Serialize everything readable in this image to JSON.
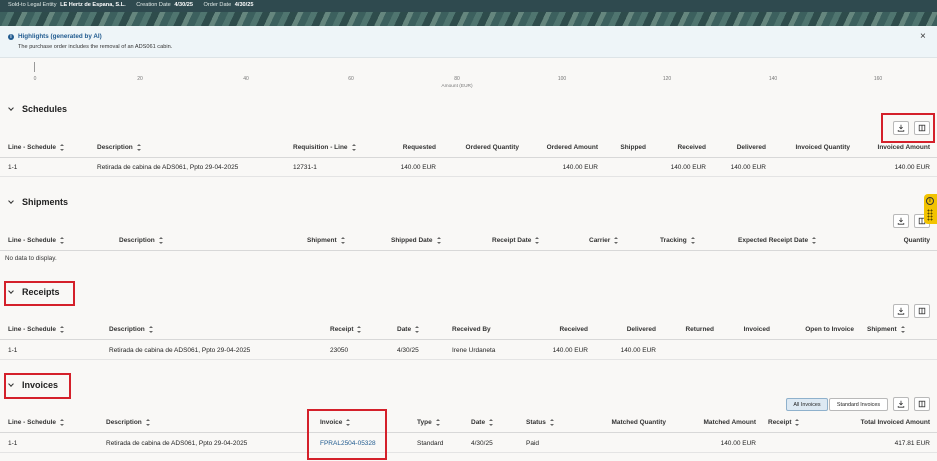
{
  "header": {
    "legal_entity_label": "Sold-to Legal Entity",
    "legal_entity_value": "LE Hertz de Espana, S.L.",
    "creation_date_label": "Creation Date",
    "creation_date_value": "4/30/25",
    "order_date_label": "Order Date",
    "order_date_value": "4/30/25"
  },
  "highlights": {
    "icon": "info-icon",
    "title": "Highlights (generated by AI)",
    "text": "The purchase order includes the removal of an ADS061 cabin.",
    "close_icon": "close-icon"
  },
  "axis": {
    "ticks": [
      "0",
      "20",
      "40",
      "60",
      "80",
      "100",
      "120",
      "140",
      "160"
    ],
    "title": "Amount (EUR)"
  },
  "schedules": {
    "title": "Schedules",
    "columns": [
      "Line - Schedule",
      "Description",
      "Requisition - Line",
      "Requested",
      "Ordered Quantity",
      "Ordered Amount",
      "Shipped",
      "Received",
      "Delivered",
      "Invoiced Quantity",
      "Invoiced Amount"
    ],
    "rows": [
      [
        "1-1",
        "Retirada de cabina de ADS061, Ppto 29-04-2025",
        "12731-1",
        "140.00 EUR",
        "",
        "140.00 EUR",
        "",
        "140.00 EUR",
        "140.00 EUR",
        "",
        "140.00 EUR"
      ]
    ]
  },
  "shipments": {
    "title": "Shipments",
    "columns": [
      "Line - Schedule",
      "Description",
      "Shipment",
      "Shipped Date",
      "Receipt Date",
      "Carrier",
      "Tracking",
      "Expected Receipt Date",
      "Quantity"
    ],
    "empty": "No data to display."
  },
  "receipts": {
    "title": "Receipts",
    "columns": [
      "Line - Schedule",
      "Description",
      "Receipt",
      "Date",
      "Received By",
      "Received",
      "Delivered",
      "Returned",
      "Invoiced",
      "Open to Invoice",
      "Shipment"
    ],
    "rows": [
      [
        "1-1",
        "Retirada de cabina de ADS061, Ppto 29-04-2025",
        "23050",
        "4/30/25",
        "Irene Urdaneta",
        "140.00 EUR",
        "140.00 EUR",
        "",
        "",
        "",
        ""
      ]
    ]
  },
  "invoices": {
    "title": "Invoices",
    "filter_all": "All Invoices",
    "filter_standard": "Standard Invoices",
    "columns": [
      "Line - Schedule",
      "Description",
      "Invoice",
      "Type",
      "Date",
      "Status",
      "Matched Quantity",
      "Matched Amount",
      "Receipt",
      "Total Invoiced Amount"
    ],
    "rows": [
      [
        "1-1",
        "Retirada de cabina de ADS061, Ppto 29-04-2025",
        "FPRAL2504-05328",
        "Standard",
        "4/30/25",
        "Paid",
        "",
        "140.00 EUR",
        "",
        "417.81 EUR"
      ]
    ]
  },
  "icons": {
    "download": "download-icon",
    "columns": "columns-icon",
    "side_panel": "info-icon"
  },
  "colors": {
    "accent": "#1f5a8f",
    "annotation": "#d4202a",
    "header_bg": "#2f4a4f"
  }
}
